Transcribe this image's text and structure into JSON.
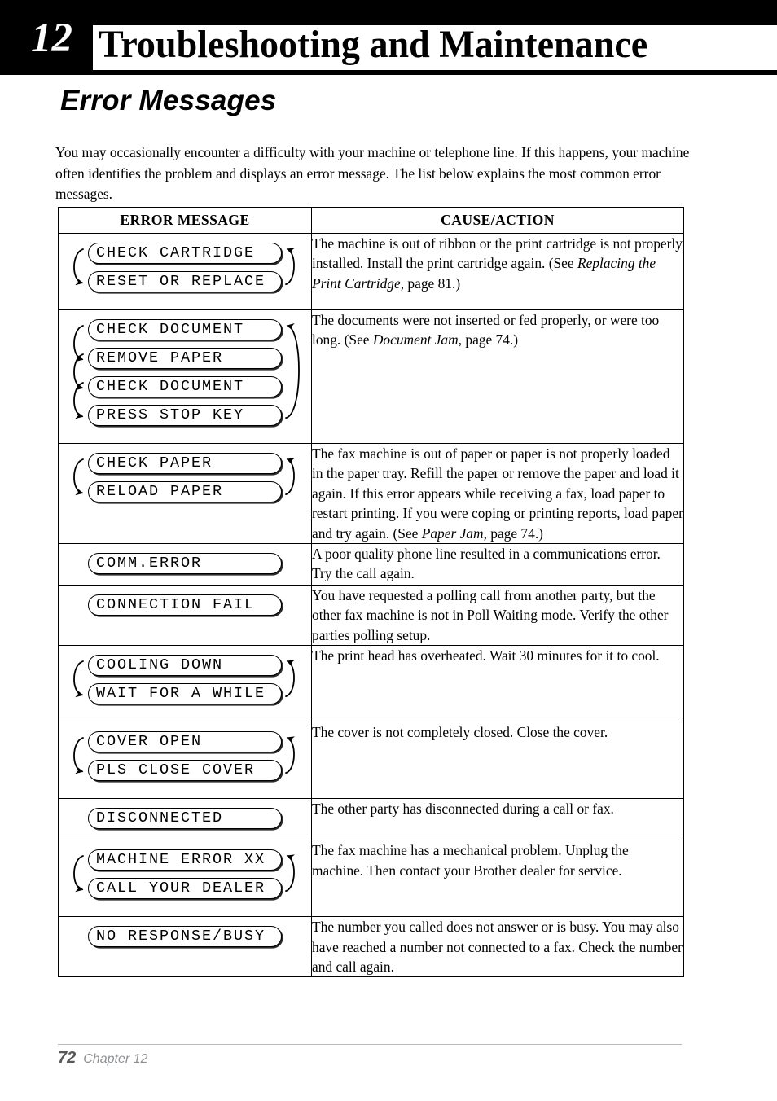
{
  "header": {
    "chapter_number": "12",
    "title": "Troubleshooting and Maintenance"
  },
  "section": {
    "heading": "Error Messages",
    "intro": "You may occasionally encounter a difficulty with your machine or telephone line. If this happens, your machine often identifies the problem and displays an error message. The list below explains the most common error messages."
  },
  "table": {
    "columns": [
      "ERROR MESSAGE",
      "CAUSE/ACTION"
    ],
    "rows": [
      {
        "messages": [
          "CHECK CARTRIDGE",
          "RESET OR REPLACE"
        ],
        "cycle": true,
        "action_html": "The machine is out of ribbon or the print cartridge is not properly installed. Install the print cartridge again. (See <span class=\"it\">Replacing the Print Cartridge</span>, page 81.)"
      },
      {
        "messages": [
          "CHECK DOCUMENT",
          "REMOVE PAPER",
          "CHECK DOCUMENT",
          "PRESS STOP KEY"
        ],
        "cycle": true,
        "action_html": "The documents were not inserted or fed properly, or were too long. (See <span class=\"it\">Document Jam</span>, page 74.)"
      },
      {
        "messages": [
          "CHECK PAPER",
          "RELOAD PAPER"
        ],
        "cycle": true,
        "action_html": "The fax machine is out of paper or paper is not properly loaded in the paper tray. Refill the paper or remove the paper and load it again. If this error appears while receiving a fax, load paper to restart printing. If you were coping or printing reports, load paper and try again. (See <span class=\"it\">Paper Jam</span>, page 74.)"
      },
      {
        "messages": [
          "COMM.ERROR"
        ],
        "cycle": false,
        "action_html": "A poor quality phone line resulted in a communications error. Try the call again."
      },
      {
        "messages": [
          "CONNECTION FAIL"
        ],
        "cycle": false,
        "action_html": "You have requested a polling call from another party, but the other fax machine is not in Poll Waiting mode. Verify the other parties polling setup."
      },
      {
        "messages": [
          "COOLING DOWN",
          "WAIT FOR A WHILE"
        ],
        "cycle": true,
        "action_html": "The print head has overheated. Wait 30 minutes for it to cool."
      },
      {
        "messages": [
          "COVER OPEN",
          "PLS CLOSE COVER"
        ],
        "cycle": true,
        "action_html": "The cover is not completely closed. Close the cover."
      },
      {
        "messages": [
          "DISCONNECTED"
        ],
        "cycle": false,
        "action_html": "The other party has disconnected during a call or fax."
      },
      {
        "messages": [
          "MACHINE ERROR XX",
          "CALL YOUR DEALER"
        ],
        "cycle": true,
        "action_html": "The fax machine has a mechanical problem. Unplug the machine. Then contact your Brother dealer for service."
      },
      {
        "messages": [
          "NO RESPONSE/BUSY"
        ],
        "cycle": false,
        "action_html": "The number you called does not answer or is busy. You may also have reached a number not connected to a fax. Check the number and call again."
      }
    ]
  },
  "footer": {
    "page_number": "72",
    "chapter_label": "Chapter 12"
  },
  "colors": {
    "header_band": "#000000",
    "header_text": "#ffffff",
    "body_text": "#000000",
    "footer_page": "#58595b",
    "footer_label": "#8e9093",
    "footer_rule": "#b9b9b9"
  }
}
